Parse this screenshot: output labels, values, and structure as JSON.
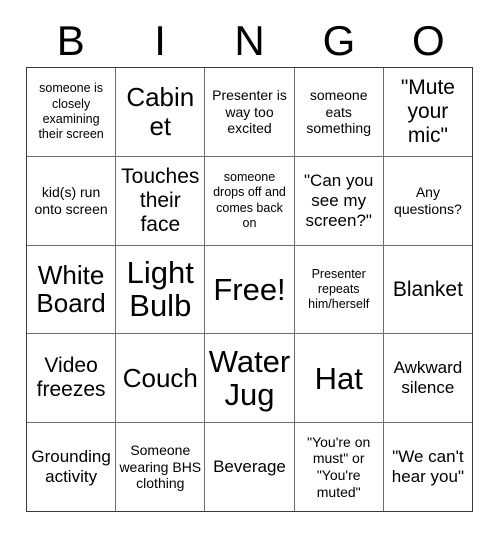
{
  "card": {
    "title": "BINGO",
    "header_letters": [
      "B",
      "I",
      "N",
      "G",
      "O"
    ],
    "grid_size": "5x5",
    "free_space_label": "Free!",
    "colors": {
      "background": "#ffffff",
      "text": "#000000",
      "grid_line": "#6f6f6f",
      "frame": "#3a3a3a"
    },
    "rows": [
      [
        {
          "text": "someone is closely examining their screen",
          "size": "t-xs"
        },
        {
          "text": "Cabinet",
          "size": "t-xl"
        },
        {
          "text": "Presenter is way too excited",
          "size": "t-sm"
        },
        {
          "text": "someone eats something",
          "size": "t-sm"
        },
        {
          "text": "\"Mute your mic\"",
          "size": "t-lg"
        }
      ],
      [
        {
          "text": "kid(s) run onto screen",
          "size": "t-sm"
        },
        {
          "text": "Touches their face",
          "size": "t-lg"
        },
        {
          "text": "someone drops off and comes back on",
          "size": "t-xs"
        },
        {
          "text": "\"Can you see my screen?\"",
          "size": "t-md"
        },
        {
          "text": "Any questions?",
          "size": "t-sm"
        }
      ],
      [
        {
          "text": "White Board",
          "size": "t-xl"
        },
        {
          "text": "Light Bulb",
          "size": "t-xxl"
        },
        {
          "text": "Free!",
          "size": "t-xxl"
        },
        {
          "text": "Presenter repeats him/herself",
          "size": "t-xs"
        },
        {
          "text": "Blanket",
          "size": "t-lg"
        }
      ],
      [
        {
          "text": "Video freezes",
          "size": "t-lg"
        },
        {
          "text": "Couch",
          "size": "t-xl"
        },
        {
          "text": "Water Jug",
          "size": "t-xxl"
        },
        {
          "text": "Hat",
          "size": "t-xxl"
        },
        {
          "text": "Awkward silence",
          "size": "t-md"
        }
      ],
      [
        {
          "text": "Grounding activity",
          "size": "t-md"
        },
        {
          "text": "Someone wearing BHS clothing",
          "size": "t-sm"
        },
        {
          "text": "Beverage",
          "size": "t-md"
        },
        {
          "text": "\"You're on must\" or \"You're muted\"",
          "size": "t-sm"
        },
        {
          "text": "\"We can't hear you\"",
          "size": "t-md"
        }
      ]
    ]
  }
}
